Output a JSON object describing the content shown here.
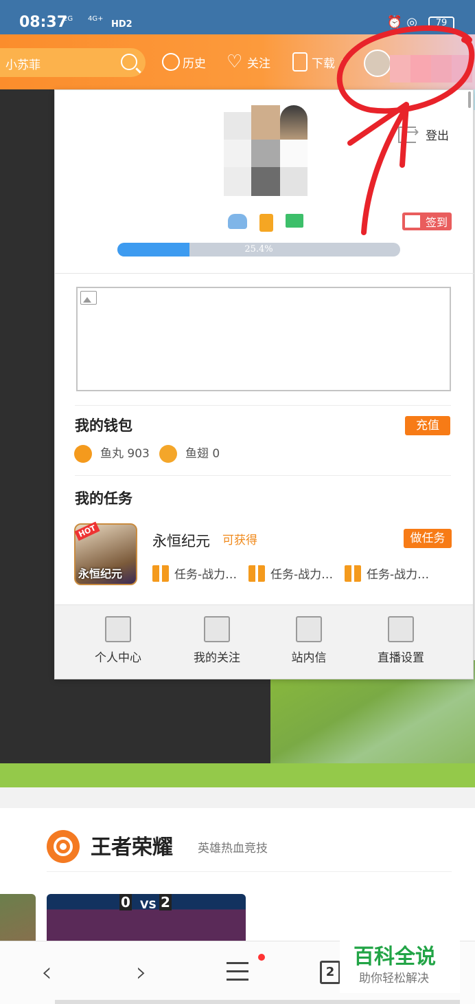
{
  "status_bar": {
    "time": "08:37",
    "network1": "2G",
    "network2": "4G+",
    "hd": "HD2",
    "battery": "79"
  },
  "topnav": {
    "search_text": "小苏菲",
    "history_label": "历史",
    "follow_label": "关注",
    "download_label": "下载"
  },
  "popup": {
    "logout_label": "登出",
    "signin_label": "签到",
    "progress_text": "25.4%",
    "progress_value": 0.254,
    "wallet": {
      "title": "我的钱包",
      "recharge_label": "充值",
      "yuwan_label": "鱼丸 903",
      "yuchi_label": "鱼翅 0"
    },
    "tasks": {
      "title": "我的任务",
      "game_name": "永恒纪元",
      "game_icon_text": "永恒纪元",
      "hot_badge": "HOT",
      "obtain_label": "可获得",
      "do_task_label": "做任务",
      "task1": "任务-战力…",
      "task2": "任务-战力…",
      "task3": "任务-战力…"
    },
    "footer": {
      "profile_label": "个人中心",
      "follows_label": "我的关注",
      "messages_label": "站内信",
      "live_settings_label": "直播设置"
    }
  },
  "section": {
    "title": "王者荣耀",
    "subtitle": "英雄热血竞技",
    "vs_text": "VS",
    "score_left": "0",
    "score_right": "2"
  },
  "bottom_nav": {
    "tabs_count": "2"
  },
  "watermark": {
    "title": "百科全说",
    "subtitle": "助你轻松解决"
  },
  "colors": {
    "accent_orange": "#f77b16",
    "progress_blue": "#3d9bf0",
    "annotation_red": "#e8232a"
  }
}
